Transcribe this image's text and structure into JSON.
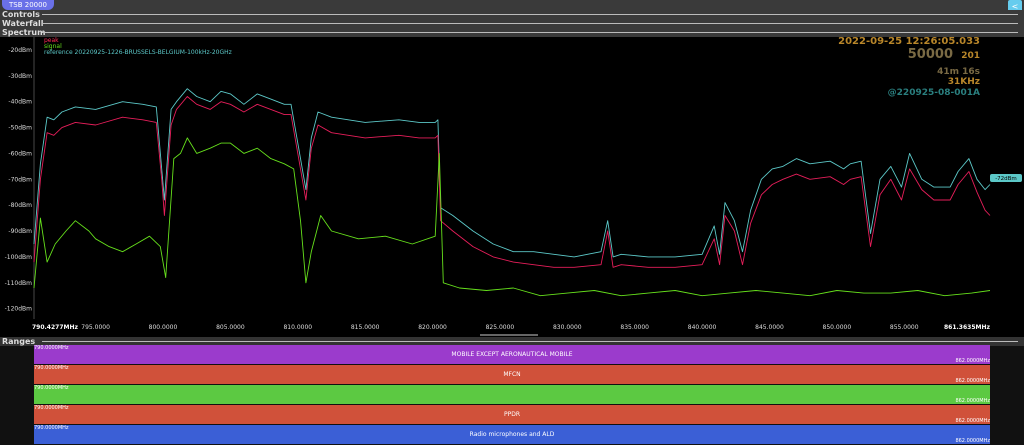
{
  "tab": {
    "label": "TSB 20000"
  },
  "corner_button": {
    "icon": "share-icon",
    "glyph": "<"
  },
  "sections": {
    "controls": "Controls",
    "waterfall": "Waterfall",
    "spectrum": "Spectrum",
    "ranges": "Ranges"
  },
  "overlay": {
    "timestamp": "2022-09-25 12:26:05.033",
    "count": "50000",
    "count_sub": "201",
    "duration": "41m 16s",
    "bandwidth": "31KHz",
    "dataset": "@220925-08-001A"
  },
  "marker": {
    "label": "-72dBm"
  },
  "chart_data": {
    "type": "line",
    "xlabel": "",
    "ylabel": "",
    "x_start_label": "790.4277MHz",
    "x_end_label": "861.3635MHz",
    "xlim": [
      790.4277,
      861.3635
    ],
    "ylim": [
      -124,
      -15
    ],
    "x_ticks": [
      "795.0000",
      "800.0000",
      "805.0000",
      "810.0000",
      "815.0000",
      "820.0000",
      "825.0000",
      "830.0000",
      "835.0000",
      "840.0000",
      "845.0000",
      "850.0000",
      "855.0000"
    ],
    "x_tick_values": [
      795,
      800,
      805,
      810,
      815,
      820,
      825,
      830,
      835,
      840,
      845,
      850,
      855
    ],
    "y_ticks": [
      "-20dBm",
      "-30dBm",
      "-40dBm",
      "-50dBm",
      "-60dBm",
      "-70dBm",
      "-80dBm",
      "-90dBm",
      "-100dBm",
      "-110dBm",
      "-120dBm"
    ],
    "y_tick_values": [
      -20,
      -30,
      -40,
      -50,
      -60,
      -70,
      -80,
      -90,
      -100,
      -110,
      -120
    ],
    "legend_placement": "top-left",
    "series": [
      {
        "name": "reference 20220925-1226-BRUSSELS-BELGIUM-100kHz-20GHz",
        "color": "#5cc8c8",
        "x": [
          790.43,
          790.9,
          791.4,
          791.9,
          792.5,
          793.5,
          795.0,
          797.0,
          798.5,
          799.5,
          799.9,
          800.1,
          800.6,
          801.0,
          801.8,
          802.5,
          803.5,
          804.3,
          805.0,
          806.0,
          807.0,
          808.0,
          809.0,
          809.5,
          810.2,
          810.6,
          811.0,
          811.5,
          812.5,
          815.0,
          817.5,
          819.0,
          820.2,
          820.4,
          820.6,
          821.5,
          823.0,
          824.5,
          826.0,
          827.5,
          829.0,
          830.5,
          832.5,
          833.0,
          833.4,
          834.0,
          836.0,
          838.0,
          840.0,
          840.9,
          841.3,
          841.7,
          842.4,
          843.0,
          843.6,
          844.4,
          845.2,
          846.0,
          847.0,
          848.0,
          849.5,
          850.5,
          851.0,
          851.8,
          852.5,
          853.2,
          854.0,
          854.8,
          855.4,
          856.3,
          857.2,
          858.4,
          859.0,
          859.8,
          860.4,
          861.0,
          861.36
        ],
        "values": [
          -95,
          -64,
          -46,
          -47,
          -44,
          -42,
          -43,
          -40,
          -41,
          -42,
          -66,
          -78,
          -43,
          -40,
          -35,
          -38,
          -40,
          -36,
          -37,
          -41,
          -37,
          -39,
          -41,
          -41,
          -62,
          -74,
          -54,
          -44,
          -46,
          -48,
          -47,
          -48,
          -48,
          -47,
          -81,
          -84,
          -90,
          -95,
          -98,
          -98,
          -99,
          -100,
          -98,
          -86,
          -100,
          -99,
          -100,
          -100,
          -99,
          -88,
          -99,
          -79,
          -86,
          -98,
          -82,
          -70,
          -66,
          -65,
          -62,
          -64,
          -63,
          -66,
          -64,
          -63,
          -91,
          -70,
          -65,
          -73,
          -60,
          -70,
          -73,
          -73,
          -67,
          -62,
          -70,
          -74,
          -72
        ]
      },
      {
        "name": "peak",
        "color": "#e61e5a",
        "x": [
          790.43,
          790.9,
          791.4,
          791.9,
          792.5,
          793.5,
          795.0,
          797.0,
          798.5,
          799.5,
          799.9,
          800.1,
          800.6,
          801.0,
          801.8,
          802.5,
          803.5,
          804.3,
          805.0,
          806.0,
          807.0,
          808.0,
          809.0,
          809.5,
          810.2,
          810.6,
          811.0,
          811.5,
          812.5,
          815.0,
          817.5,
          819.0,
          820.2,
          820.4,
          820.6,
          821.5,
          823.0,
          824.5,
          826.0,
          827.5,
          829.0,
          830.5,
          832.5,
          833.0,
          833.4,
          834.0,
          836.0,
          838.0,
          840.0,
          840.9,
          841.3,
          841.7,
          842.4,
          843.0,
          843.6,
          844.4,
          845.2,
          846.0,
          847.0,
          848.0,
          849.5,
          850.5,
          851.0,
          851.8,
          852.5,
          853.2,
          854.0,
          854.8,
          855.4,
          856.3,
          857.2,
          858.4,
          859.0,
          859.8,
          860.4,
          861.0,
          861.36
        ],
        "values": [
          -102,
          -70,
          -52,
          -53,
          -50,
          -48,
          -49,
          -46,
          -47,
          -48,
          -70,
          -84,
          -49,
          -43,
          -38,
          -41,
          -43,
          -40,
          -41,
          -44,
          -41,
          -43,
          -45,
          -45,
          -66,
          -78,
          -58,
          -49,
          -52,
          -54,
          -53,
          -54,
          -54,
          -53,
          -86,
          -90,
          -96,
          -100,
          -102,
          -103,
          -104,
          -104,
          -103,
          -90,
          -104,
          -103,
          -104,
          -104,
          -103,
          -93,
          -103,
          -84,
          -90,
          -103,
          -87,
          -76,
          -72,
          -70,
          -68,
          -70,
          -69,
          -72,
          -70,
          -69,
          -96,
          -76,
          -70,
          -78,
          -66,
          -74,
          -78,
          -78,
          -72,
          -67,
          -75,
          -82,
          -84
        ]
      },
      {
        "name": "signal",
        "color": "#66e01c",
        "x": [
          790.43,
          790.9,
          791.4,
          792.0,
          792.8,
          793.5,
          794.5,
          795.0,
          796.0,
          797.0,
          798.0,
          799.0,
          799.8,
          800.2,
          800.8,
          801.3,
          801.8,
          802.5,
          803.5,
          804.3,
          805.0,
          806.0,
          807.0,
          808.0,
          809.0,
          809.7,
          810.2,
          810.6,
          811.0,
          811.7,
          812.5,
          814.5,
          816.5,
          818.5,
          820.2,
          820.5,
          820.8,
          822.0,
          824.0,
          826.0,
          828.0,
          830.0,
          832.0,
          834.0,
          836.0,
          838.0,
          840.0,
          842.0,
          844.0,
          846.0,
          848.0,
          850.0,
          852.0,
          854.0,
          856.0,
          858.0,
          860.0,
          861.36
        ],
        "values": [
          -112,
          -85,
          -102,
          -95,
          -90,
          -86,
          -90,
          -93,
          -96,
          -98,
          -95,
          -92,
          -96,
          -108,
          -62,
          -60,
          -54,
          -60,
          -58,
          -56,
          -56,
          -60,
          -58,
          -62,
          -64,
          -66,
          -86,
          -110,
          -98,
          -84,
          -90,
          -93,
          -92,
          -95,
          -92,
          -60,
          -110,
          -112,
          -113,
          -112,
          -115,
          -114,
          -113,
          -115,
          -114,
          -113,
          -115,
          -114,
          -113,
          -114,
          -115,
          -113,
          -114,
          -114,
          -113,
          -115,
          -114,
          -113
        ]
      }
    ]
  },
  "ranges": [
    {
      "name": "MOBILE EXCEPT AERONAUTICAL MOBILE",
      "start": "790.0000MHz",
      "end": "862.0000MHz",
      "color": "#9b3bcc"
    },
    {
      "name": "MFCN",
      "start": "790.0000MHz",
      "end": "862.0000MHz",
      "color": "#d0513a"
    },
    {
      "name": "",
      "start": "790.0000MHz",
      "end": "862.0000MHz",
      "color": "#5cc942"
    },
    {
      "name": "PPDR",
      "start": "790.0000MHz",
      "end": "862.0000MHz",
      "color": "#d0513a"
    },
    {
      "name": "Radio microphones and ALD",
      "start": "790.0000MHz",
      "end": "862.0000MHz",
      "color": "#3b5fd6"
    }
  ]
}
